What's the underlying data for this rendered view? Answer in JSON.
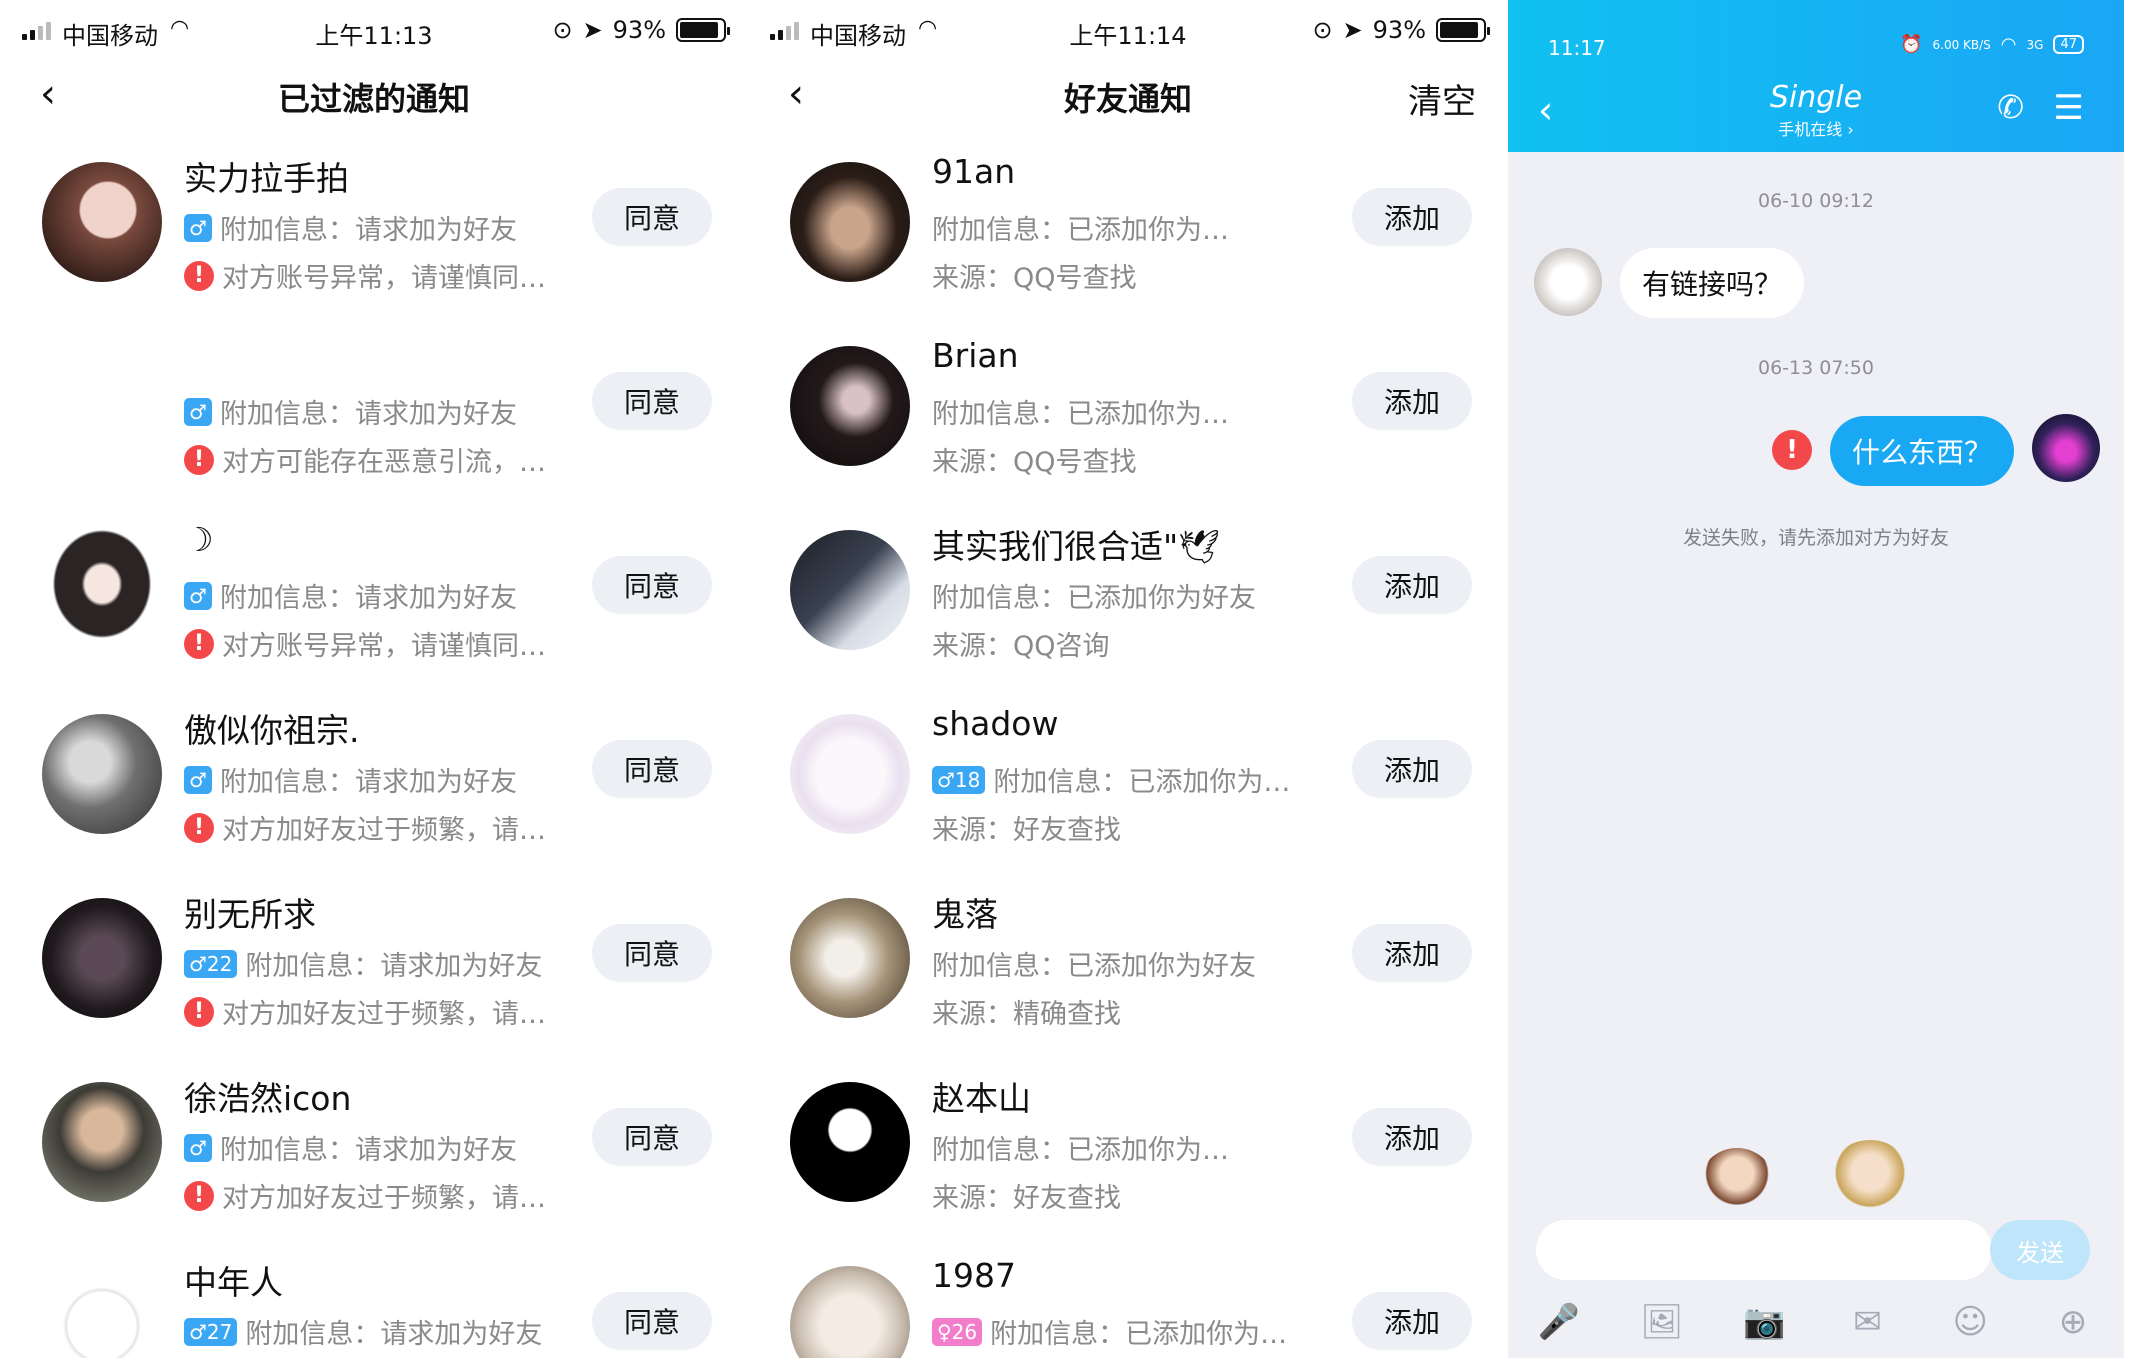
{
  "left_screen": {
    "status": {
      "carrier": "中国移动",
      "time": "上午11:13",
      "battery": "93%"
    },
    "title": "已过滤的通知",
    "items": [
      {
        "name": "实力拉手拍",
        "badge": "♂",
        "info": "附加信息：请求加为好友",
        "warning": "对方账号异常，请谨慎同…",
        "button": "同意"
      },
      {
        "name": "",
        "badge": "♂",
        "info": "附加信息：请求加为好友",
        "warning": "对方可能存在恶意引流，…",
        "button": "同意"
      },
      {
        "name": "☽",
        "badge": "♂",
        "info": "附加信息：请求加为好友",
        "warning": "对方账号异常，请谨慎同…",
        "button": "同意"
      },
      {
        "name": "傲似你祖宗.",
        "badge": "♂",
        "info": "附加信息：请求加为好友",
        "warning": "对方加好友过于频繁，请…",
        "button": "同意"
      },
      {
        "name": "别无所求",
        "badge": "♂22",
        "info": "附加信息：请求加为好友",
        "warning": "对方加好友过于频繁，请…",
        "button": "同意"
      },
      {
        "name": "徐浩然icon",
        "badge": "♂",
        "info": "附加信息：请求加为好友",
        "warning": "对方加好友过于频繁，请…",
        "button": "同意"
      },
      {
        "name": "中年人",
        "badge": "♂27",
        "info": "附加信息：请求加为好友",
        "warning": "",
        "button": "同意"
      }
    ]
  },
  "middle_screen": {
    "status": {
      "carrier": "中国移动",
      "time": "上午11:14",
      "battery": "93%"
    },
    "title": "好友通知",
    "action": "清空",
    "items": [
      {
        "name": "91an",
        "badge": "",
        "info": "附加信息：已添加你为…",
        "source": "来源：QQ号查找",
        "button": "添加"
      },
      {
        "name": "Brian",
        "badge": "",
        "info": "附加信息：已添加你为…",
        "source": "来源：QQ号查找",
        "button": "添加"
      },
      {
        "name": "其实我们很合适\"🕊",
        "badge": "",
        "info": "附加信息：已添加你为好友",
        "source": "来源：QQ咨询",
        "button": "添加"
      },
      {
        "name": "shadow",
        "badge": "♂18",
        "info": "附加信息：已添加你为…",
        "source": "来源：好友查找",
        "button": "添加"
      },
      {
        "name": "鬼落",
        "badge": "",
        "info": "附加信息：已添加你为好友",
        "source": "来源：精确查找",
        "button": "添加"
      },
      {
        "name": "赵本山",
        "badge": "",
        "info": "附加信息：已添加你为…",
        "source": "来源：好友查找",
        "button": "添加"
      },
      {
        "name": "1987",
        "badge": "♀26",
        "info": "附加信息：已添加你为…",
        "source": "",
        "button": "添加"
      }
    ]
  },
  "right_screen": {
    "status": {
      "time": "11:17",
      "net_speed": "6.00 KB/S",
      "net": "3G",
      "battery": "47"
    },
    "contact_name": "Single",
    "contact_status": "手机在线 ›",
    "messages": [
      {
        "timestamp": "06-10 09:12",
        "text": "有链接吗？",
        "direction": "in"
      },
      {
        "timestamp": "06-13 07:50",
        "text": "什么东西？",
        "direction": "out"
      }
    ],
    "fail_notice": "发送失败，请先添加对方为好友",
    "send_label": "发送"
  },
  "colors": {
    "accent": "#19a8f4",
    "warning": "#f3484a",
    "badge_male": "#3aa7f5",
    "badge_female": "#f27ecb",
    "button_bg": "#eceff4"
  }
}
